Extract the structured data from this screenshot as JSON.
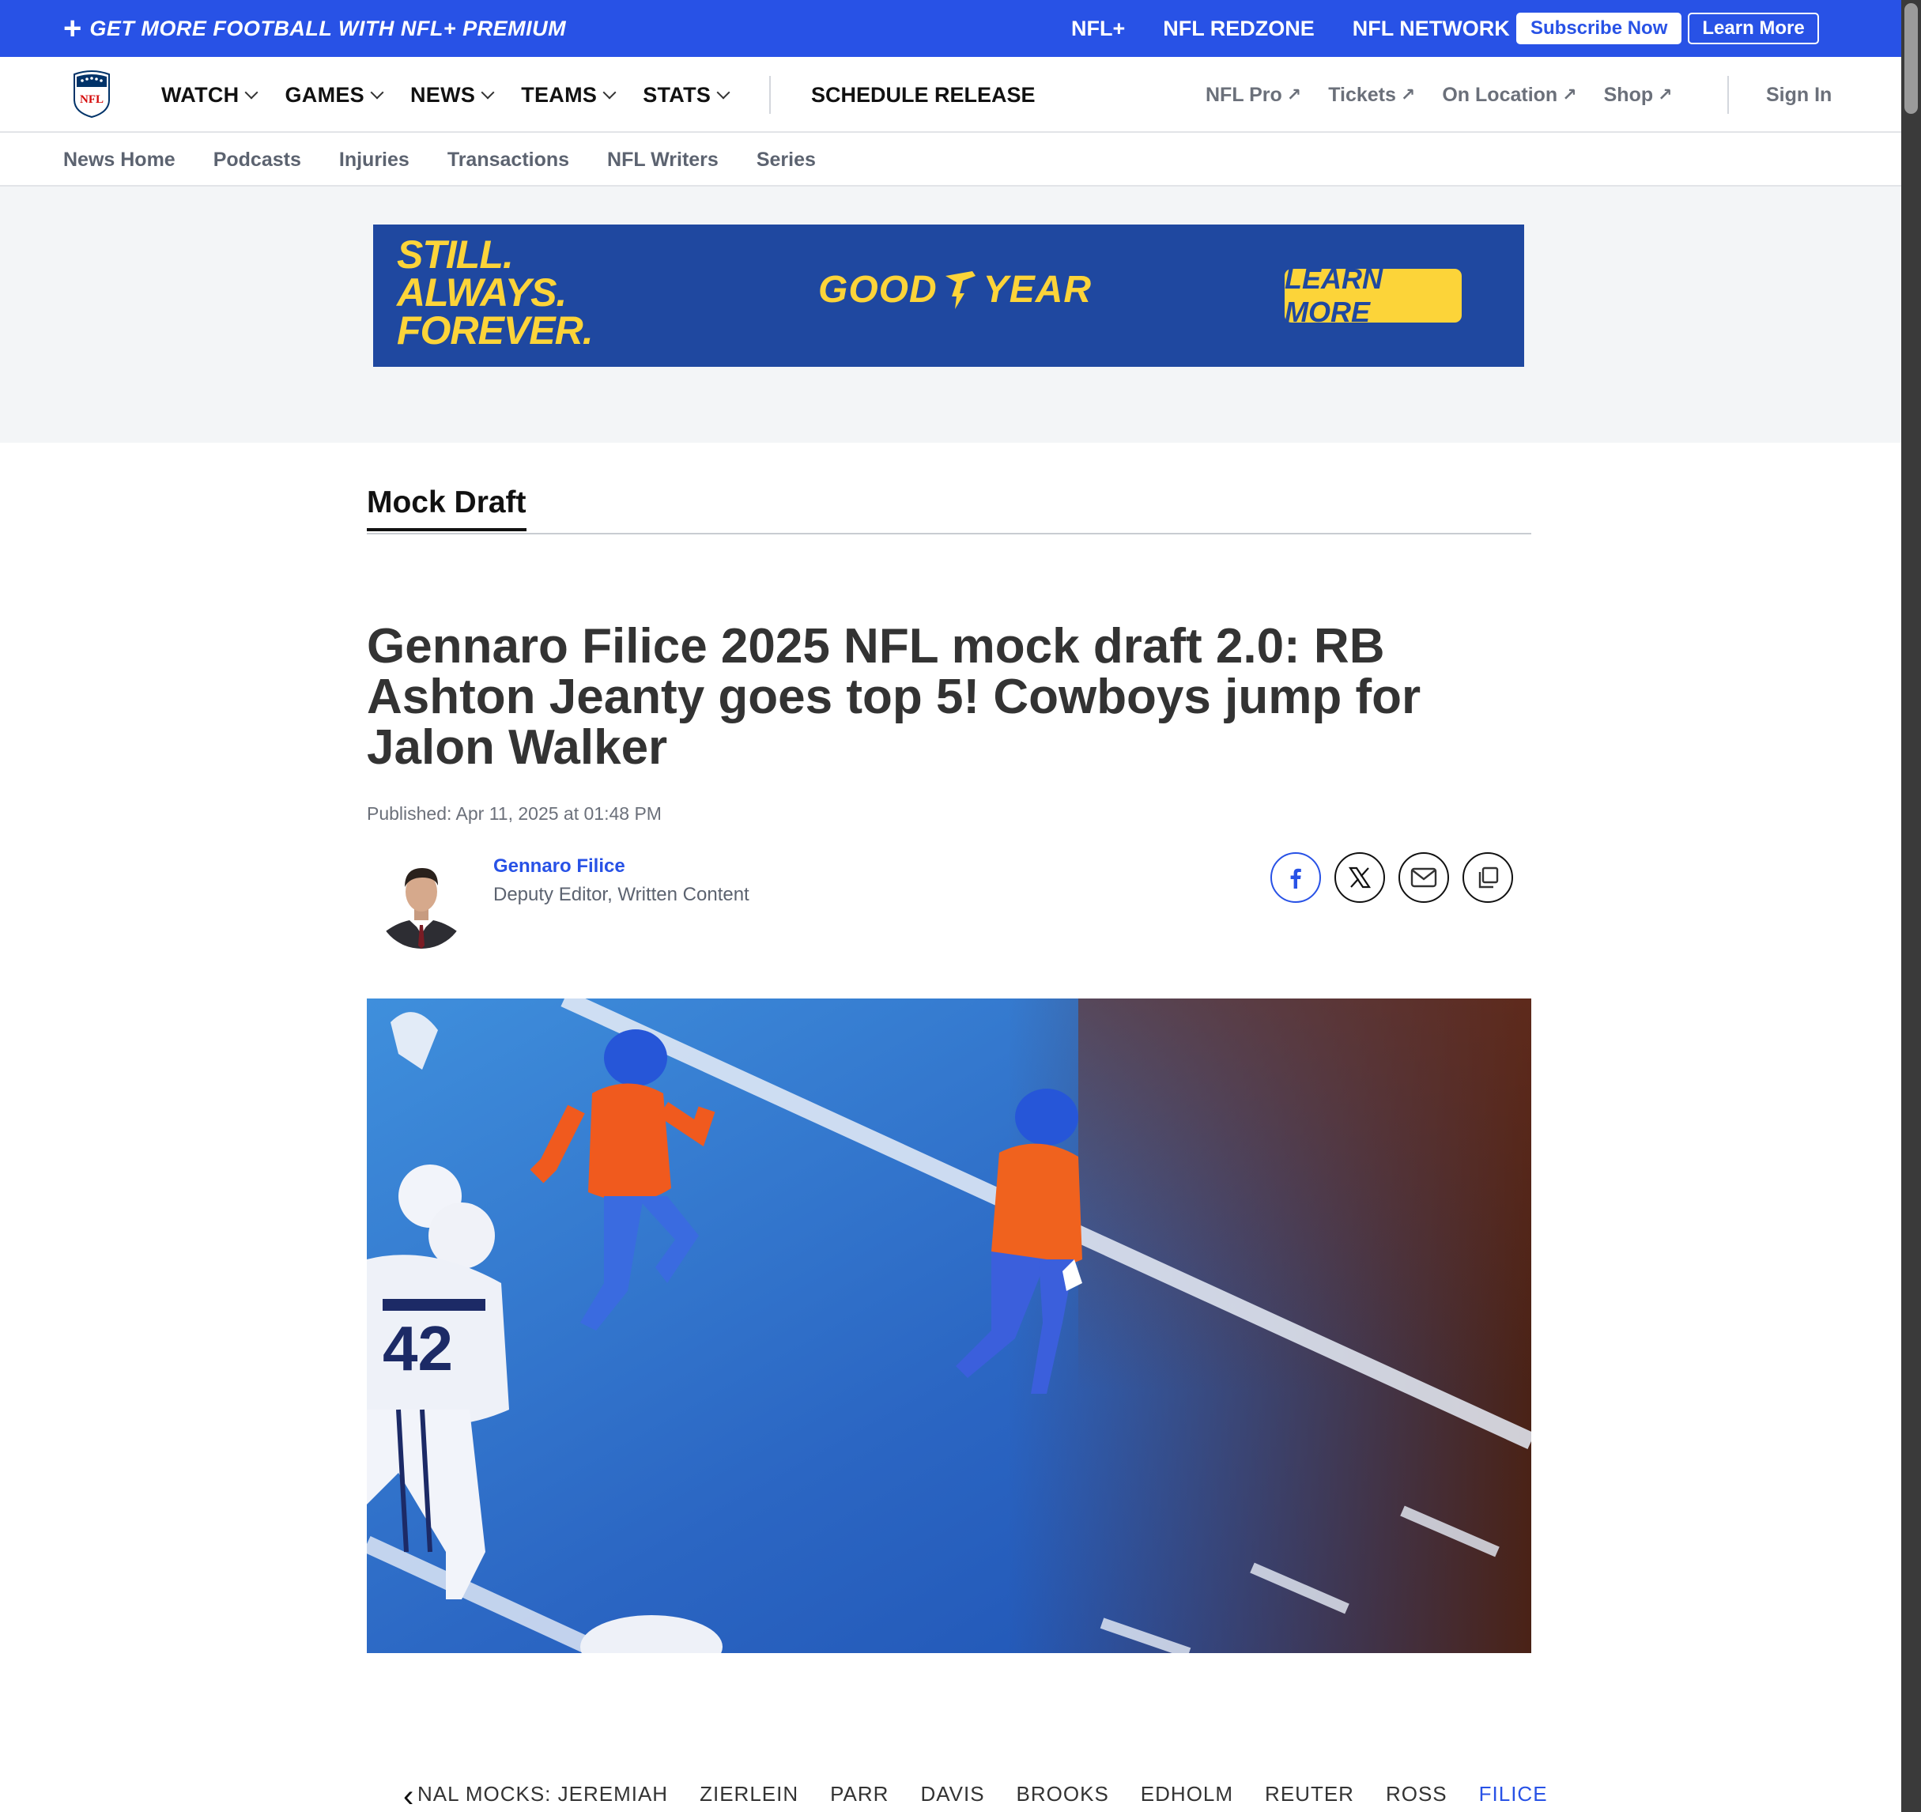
{
  "promo": {
    "plus": "+",
    "text": "GET MORE FOOTBALL WITH NFL+ PREMIUM",
    "links": [
      "NFL+",
      "NFL REDZONE",
      "NFL NETWORK"
    ],
    "subscribe_label": "Subscribe Now",
    "learn_label": "Learn More"
  },
  "nav": {
    "items": [
      "WATCH",
      "GAMES",
      "NEWS",
      "TEAMS",
      "STATS"
    ],
    "schedule_label": "SCHEDULE RELEASE",
    "external": [
      "NFL Pro",
      "Tickets",
      "On Location",
      "Shop"
    ],
    "ext_arrow": "↗",
    "signin_label": "Sign In",
    "logo_text": "NFL"
  },
  "subnav": {
    "items": [
      "News Home",
      "Podcasts",
      "Injuries",
      "Transactions",
      "NFL Writers",
      "Series"
    ]
  },
  "ad": {
    "slogan": [
      "STILL.",
      "ALWAYS.",
      "FOREVER."
    ],
    "brand_left": "GOOD",
    "brand_right": "YEAR",
    "cta": "LEARN MORE"
  },
  "article": {
    "section": "Mock Draft",
    "headline": "Gennaro Filice 2025 NFL mock draft 2.0: RB Ashton Jeanty goes top 5! Cowboys jump for Jalon Walker",
    "published": "Published: Apr 11, 2025 at 01:48 PM",
    "author_name": "Gennaro Filice",
    "author_title": "Deputy Editor, Written Content",
    "share_icons": [
      "facebook-icon",
      "x-icon",
      "email-icon",
      "copy-link-icon"
    ]
  },
  "carousel": {
    "prev_glyph": "‹",
    "items": [
      "NAL MOCKS: JEREMIAH",
      "ZIERLEIN",
      "PARR",
      "DAVIS",
      "BROOKS",
      "EDHOLM",
      "REUTER",
      "ROSS",
      "FILICE"
    ],
    "active_index": 8
  },
  "colors": {
    "brand_blue": "#2852e6",
    "ad_blue": "#1f48a0",
    "ad_yellow": "#fcd439"
  }
}
